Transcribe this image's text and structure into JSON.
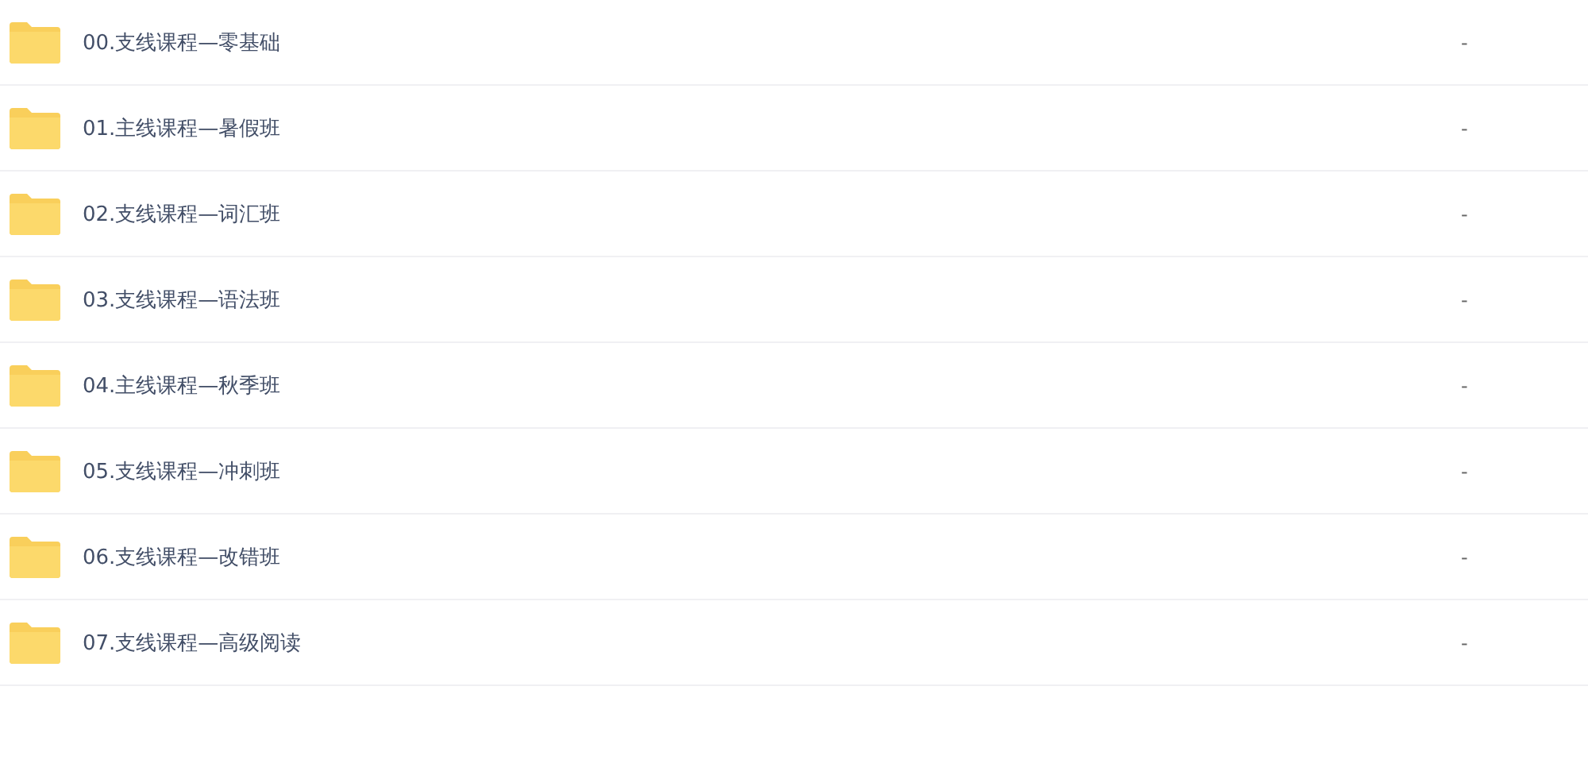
{
  "files": [
    {
      "name": "00.支线课程—零基础",
      "size": "-"
    },
    {
      "name": "01.主线课程—暑假班",
      "size": "-"
    },
    {
      "name": "02.支线课程—词汇班",
      "size": "-"
    },
    {
      "name": "03.支线课程—语法班",
      "size": "-"
    },
    {
      "name": "04.主线课程—秋季班",
      "size": "-"
    },
    {
      "name": "05.支线课程—冲刺班",
      "size": "-"
    },
    {
      "name": "06.支线课程—改错班",
      "size": "-"
    },
    {
      "name": "07.支线课程—高级阅读",
      "size": "-"
    }
  ]
}
